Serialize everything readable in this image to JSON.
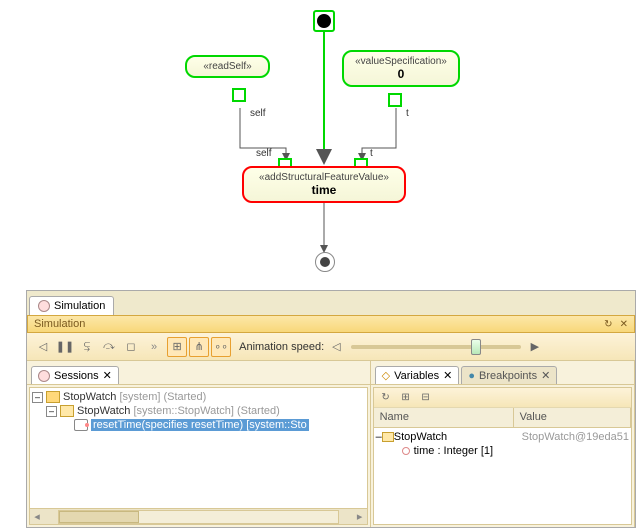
{
  "diagram": {
    "nodes": {
      "readSelf": {
        "stereo": "«readSelf»",
        "name": ""
      },
      "valueSpec": {
        "stereo": "«valueSpecification»",
        "name": "0"
      },
      "addFeature": {
        "stereo": "«addStructuralFeatureValue»",
        "name": "time"
      }
    },
    "pin_labels": {
      "self_out": "self",
      "t_out": "t",
      "self_in": "self",
      "t_in": "t"
    }
  },
  "panel": {
    "tab": "Simulation",
    "header": "Simulation",
    "toolbar": {
      "anim_label": "Animation speed:"
    },
    "sessions": {
      "tab": "Sessions",
      "root": {
        "name": "StopWatch",
        "suffix": "[system] (Started)"
      },
      "child": {
        "name": "StopWatch",
        "suffix": "[system::StopWatch] (Started)"
      },
      "leaf": "resetTime(specifies resetTime) [system::Sto"
    },
    "vars": {
      "tabs": {
        "variables": "Variables",
        "breakpoints": "Breakpoints"
      },
      "cols": {
        "name": "Name",
        "value": "Value"
      },
      "row1": {
        "name": "StopWatch",
        "value": "StopWatch@19eda51"
      },
      "row2": {
        "name": "time : Integer [1]"
      }
    }
  }
}
